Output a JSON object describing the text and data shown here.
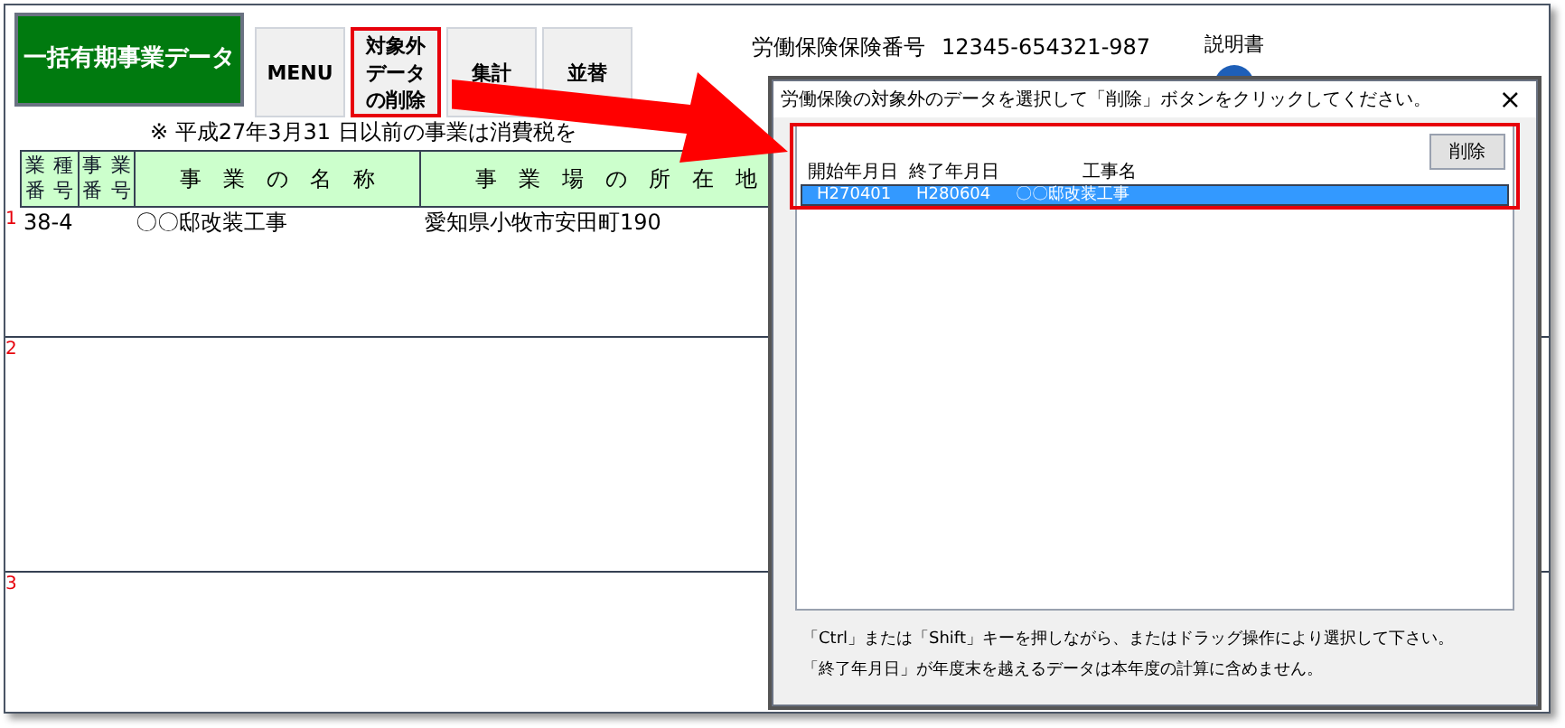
{
  "toolbar": {
    "title_button": "一括有期事業データ",
    "buttons": [
      {
        "label": "MENU",
        "highlighted": false
      },
      {
        "lines": [
          "対象外",
          "データ",
          "の削除"
        ],
        "highlighted": true
      },
      {
        "label": "集計",
        "highlighted": false
      },
      {
        "label": "並替",
        "highlighted": false
      }
    ]
  },
  "info": [
    {
      "label": "労働保険保険番号",
      "value": "12345-654321-987"
    }
  ],
  "help": {
    "label": "説明書"
  },
  "note": "※ 平成27年3月31 日以前の事業は消費税を",
  "table": {
    "columns": [
      {
        "kind": "small",
        "top": [
          "業",
          "種"
        ],
        "bottom": [
          "番",
          "号"
        ]
      },
      {
        "kind": "small",
        "top": [
          "事",
          "業"
        ],
        "bottom": [
          "番",
          "号"
        ]
      },
      {
        "kind": "wide",
        "label": "事　業　の　名　称"
      },
      {
        "kind": "wide",
        "label": "事　業　場　の　所　在　地"
      }
    ],
    "rows": [
      {
        "number": "1",
        "cells": [
          "38-4",
          "",
          "〇〇邸改装工事",
          "愛知県小牧市安田町190"
        ]
      },
      {
        "number": "2",
        "cells": []
      },
      {
        "number": "3",
        "cells": []
      }
    ]
  },
  "dialog": {
    "title": "労働保険の対象外のデータを選択して「削除」ボタンをクリックしてください。",
    "close": "×",
    "delete_button": "削除",
    "columns": [
      "開始年月日",
      "終了年月日",
      "工事名"
    ],
    "rows": [
      {
        "cells": [
          "H270401",
          "H280604",
          "〇〇邸改装工事"
        ],
        "selected": true
      }
    ],
    "footer": [
      "「Ctrl」または「Shift」キーを押しながら、またはドラッグ操作により選択して下さい。",
      "「終了年月日」が年度末を越えるデータは本年度の計算に含めません。"
    ]
  }
}
